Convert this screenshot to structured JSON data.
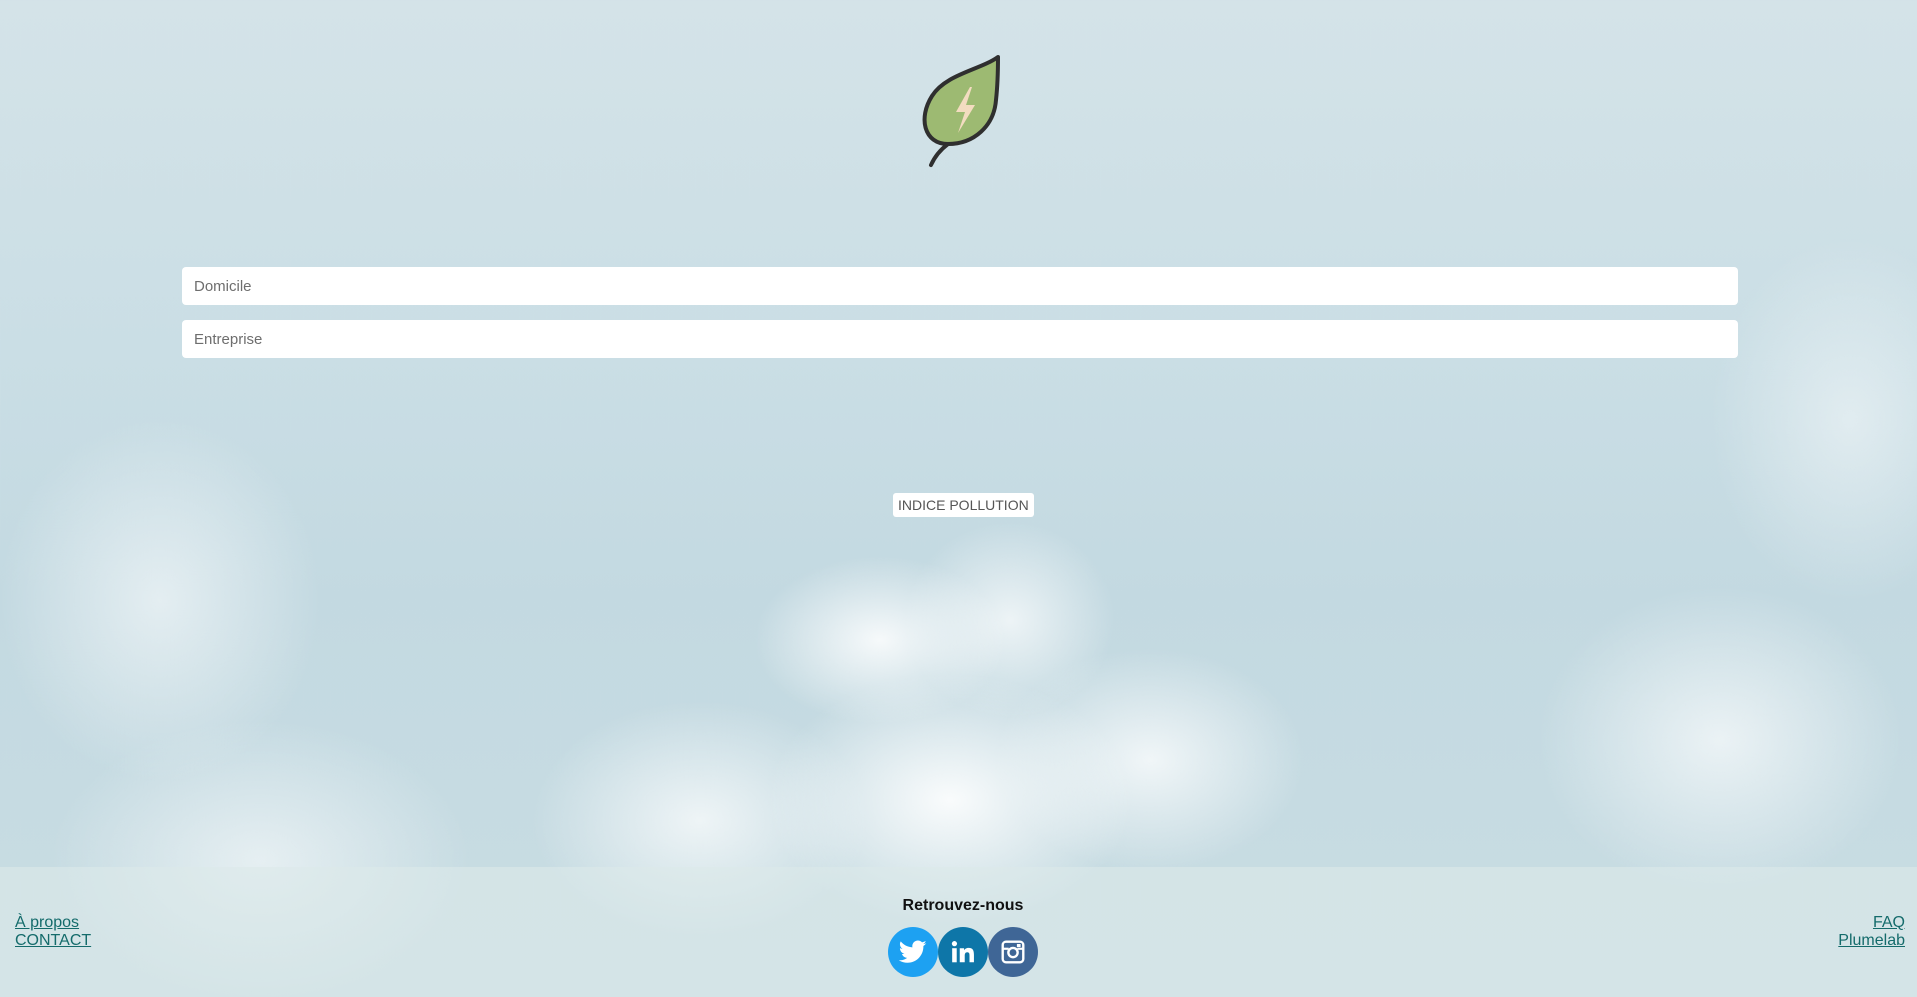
{
  "logo": {
    "icon": "leaf-lightning-icon"
  },
  "form": {
    "home": {
      "placeholder": "Domicile",
      "value": ""
    },
    "company": {
      "placeholder": "Entreprise",
      "value": ""
    }
  },
  "action": {
    "label": "INDICE POLLUTION"
  },
  "footer": {
    "left_links": [
      "À propos",
      "CONTACT"
    ],
    "title": "Retrouvez-nous",
    "right_links": [
      "FAQ",
      "Plumelab"
    ],
    "socials": [
      {
        "icon": "twitter-icon",
        "color": "#1da1f2"
      },
      {
        "icon": "linkedin-icon",
        "color": "#0e76a8"
      },
      {
        "icon": "instagram-icon",
        "color": "#3f6696"
      }
    ]
  },
  "colors": {
    "link": "#146b6b",
    "leaf": "#9dba72",
    "bolt": "#f3dcc0"
  }
}
